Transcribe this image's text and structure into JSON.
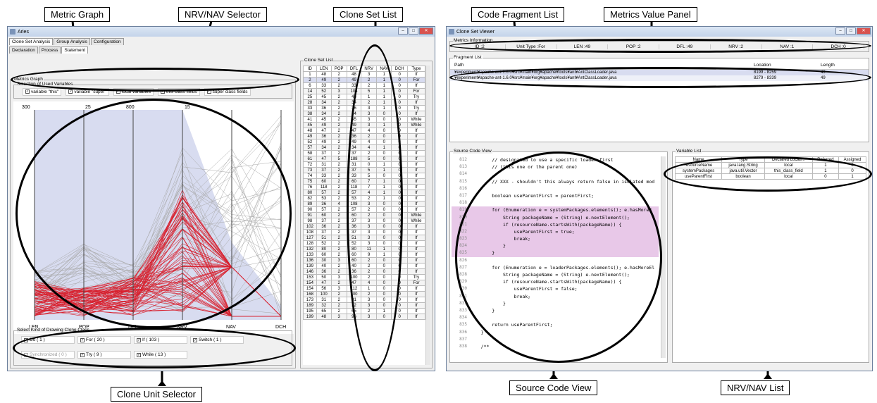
{
  "callouts": {
    "metric_graph": "Metric Graph",
    "nrv_nav_selector": "NRV/NAV Selector",
    "clone_set_list": "Clone Set List",
    "clone_unit_selector": "Clone Unit Selector",
    "code_fragment_list": "Code Fragment List",
    "metrics_value_panel": "Metrics Value Panel",
    "source_code_view": "Source Code View",
    "nrv_nav_list": "NRV/NAV List"
  },
  "aries": {
    "title": "Aries",
    "top_tabs": [
      "Clone Set Analysis",
      "Group Analysis",
      "Configuration"
    ],
    "sub_tabs": [
      "Declaration",
      "Process",
      "Statement"
    ],
    "metrics_graph_title": "Metrics Graph",
    "selection_title": "Selection of Used Variables",
    "variables": [
      "variable \"this\"",
      "variable \"super\"",
      "local variables",
      "this class fields",
      "super class fields"
    ],
    "axis_labels": [
      "LEN",
      "POP",
      "DFL",
      "NRV",
      "NAV",
      "DCH"
    ],
    "axis_top": [
      "300",
      "25",
      "800",
      "15",
      "",
      ""
    ],
    "kind_title": "Select Kind of Drawing Clone Class",
    "kinds_row1": [
      "Do ( 1 )",
      "For ( 20 )",
      "If ( 103 )",
      "Switch ( 1 )"
    ],
    "kinds_row2": [
      "Synchronized ( 0 )",
      "Try ( 9 )",
      "While ( 13 )"
    ],
    "clone_list_title": "Clone Set List",
    "clone_headers": [
      "ID",
      "LEN",
      "POP",
      "DFL",
      "NRV",
      "NAV",
      "DCH",
      "Type"
    ],
    "clone_rows": [
      [
        "1",
        "48",
        "2",
        "48",
        "3",
        "1",
        "0",
        "If"
      ],
      [
        "2",
        "49",
        "2",
        "49",
        "2",
        "1",
        "0",
        "For"
      ],
      [
        "6",
        "33",
        "2",
        "33",
        "2",
        "1",
        "0",
        "If"
      ],
      [
        "14",
        "52",
        "3",
        "104",
        "5",
        "1",
        "0",
        "For"
      ],
      [
        "25",
        "45",
        "2",
        "45",
        "1",
        "1",
        "0",
        "Try"
      ],
      [
        "28",
        "34",
        "2",
        "34",
        "2",
        "1",
        "0",
        "If"
      ],
      [
        "33",
        "36",
        "2",
        "36",
        "3",
        "1",
        "0",
        "Try"
      ],
      [
        "38",
        "34",
        "2",
        "34",
        "3",
        "0",
        "0",
        "If"
      ],
      [
        "41",
        "45",
        "2",
        "45",
        "3",
        "0",
        "0",
        "While"
      ],
      [
        "45",
        "49",
        "2",
        "49",
        "3",
        "1",
        "0",
        "While"
      ],
      [
        "48",
        "47",
        "2",
        "47",
        "4",
        "0",
        "0",
        "If"
      ],
      [
        "49",
        "36",
        "2",
        "36",
        "2",
        "0",
        "0",
        "If"
      ],
      [
        "52",
        "49",
        "2",
        "49",
        "4",
        "0",
        "0",
        "If"
      ],
      [
        "57",
        "34",
        "2",
        "34",
        "4",
        "1",
        "0",
        "If"
      ],
      [
        "58",
        "37",
        "2",
        "37",
        "2",
        "0",
        "0",
        "If"
      ],
      [
        "61",
        "47",
        "5",
        "188",
        "5",
        "0",
        "0",
        "If"
      ],
      [
        "72",
        "31",
        "2",
        "31",
        "0",
        "1",
        "0",
        "If"
      ],
      [
        "73",
        "37",
        "2",
        "37",
        "5",
        "1",
        "0",
        "If"
      ],
      [
        "74",
        "33",
        "2",
        "33",
        "5",
        "0",
        "0",
        "If"
      ],
      [
        "75",
        "60",
        "2",
        "60",
        "7",
        "1",
        "0",
        "If"
      ],
      [
        "76",
        "118",
        "2",
        "118",
        "7",
        "1",
        "0",
        "If"
      ],
      [
        "80",
        "57",
        "2",
        "57",
        "4",
        "1",
        "0",
        "If"
      ],
      [
        "82",
        "53",
        "2",
        "53",
        "2",
        "1",
        "0",
        "If"
      ],
      [
        "89",
        "36",
        "4",
        "108",
        "3",
        "0",
        "0",
        "If"
      ],
      [
        "90",
        "57",
        "2",
        "57",
        "2",
        "0",
        "0",
        "If"
      ],
      [
        "91",
        "60",
        "2",
        "60",
        "2",
        "0",
        "0",
        "While"
      ],
      [
        "98",
        "37",
        "2",
        "37",
        "3",
        "0",
        "0",
        "While"
      ],
      [
        "102",
        "36",
        "2",
        "36",
        "3",
        "0",
        "0",
        "If"
      ],
      [
        "108",
        "37",
        "2",
        "37",
        "3",
        "0",
        "0",
        "If"
      ],
      [
        "127",
        "51",
        "2",
        "51",
        "3",
        "0",
        "0",
        "If"
      ],
      [
        "128",
        "52",
        "2",
        "52",
        "3",
        "0",
        "0",
        "If"
      ],
      [
        "132",
        "80",
        "2",
        "80",
        "11",
        "1",
        "0",
        "If"
      ],
      [
        "133",
        "60",
        "2",
        "60",
        "9",
        "1",
        "0",
        "If"
      ],
      [
        "136",
        "30",
        "3",
        "60",
        "2",
        "0",
        "0",
        "If"
      ],
      [
        "139",
        "40",
        "2",
        "40",
        "2",
        "0",
        "0",
        "If"
      ],
      [
        "146",
        "36",
        "2",
        "36",
        "2",
        "0",
        "0",
        "If"
      ],
      [
        "153",
        "50",
        "3",
        "100",
        "2",
        "0",
        "0",
        "Try"
      ],
      [
        "154",
        "47",
        "2",
        "47",
        "4",
        "0",
        "0",
        "For"
      ],
      [
        "154",
        "56",
        "3",
        "112",
        "1",
        "0",
        "0",
        "If"
      ],
      [
        "168",
        "100",
        "2",
        "100",
        "2",
        "0",
        "0",
        "If"
      ],
      [
        "173",
        "31",
        "2",
        "31",
        "3",
        "0",
        "0",
        "If"
      ],
      [
        "189",
        "32",
        "2",
        "32",
        "3",
        "0",
        "0",
        "If"
      ],
      [
        "195",
        "65",
        "2",
        "65",
        "2",
        "1",
        "0",
        "If"
      ],
      [
        "199",
        "48",
        "3",
        "96",
        "3",
        "0",
        "0",
        "If"
      ]
    ]
  },
  "viewer": {
    "title": "Clone Set Viewer",
    "metrics_info_title": "Metrics Information",
    "metrics": [
      "ID :2",
      "Unit Type :For",
      "LEN :49",
      "POP :2",
      "DFL :49",
      "NRV :2",
      "NAV :1",
      "DCH :0"
    ],
    "fragment_title": "Fragment List",
    "fragment_headers": [
      "Path",
      "Location",
      "Length"
    ],
    "fragments": [
      {
        "path": "¥experiment¥apache-ant-1.6.0¥src¥main¥org¥apache¥tools¥ant¥AntClassLoader.java",
        "loc": "8199 - 8259",
        "len": "49"
      },
      {
        "path": "¥experiment¥apache-ant-1.6.0¥src¥main¥org¥apache¥tools¥ant¥AntClassLoader.java",
        "loc": "8279 - 8339",
        "len": "49"
      }
    ],
    "source_title": "Source Code View",
    "code": [
      [
        "812",
        "        // designated to use a specific loader first"
      ],
      [
        "813",
        "        // (this one or the parent one)"
      ],
      [
        "814",
        ""
      ],
      [
        "815",
        "        // XXX - shouldn't this always return false in isolated mod"
      ],
      [
        "816",
        ""
      ],
      [
        "817",
        "        boolean useParentFirst = parentFirst;"
      ],
      [
        "818",
        ""
      ],
      [
        "819",
        "        for (Enumeration e = systemPackages.elements(); e.hasMoreE"
      ],
      [
        "820",
        "            String packageName = (String) e.nextElement();"
      ],
      [
        "821",
        "            if (resourceName.startsWith(packageName)) {"
      ],
      [
        "822",
        "                useParentFirst = true;"
      ],
      [
        "823",
        "                break;"
      ],
      [
        "824",
        "            }"
      ],
      [
        "825",
        "        }"
      ],
      [
        "826",
        ""
      ],
      [
        "827",
        "        for (Enumeration e = loaderPackages.elements(); e.hasMoreEl"
      ],
      [
        "828",
        "            String packageName = (String) e.nextElement();"
      ],
      [
        "829",
        "            if (resourceName.startsWith(packageName)) {"
      ],
      [
        "830",
        "                useParentFirst = false;"
      ],
      [
        "831",
        "                break;"
      ],
      [
        "832",
        "            }"
      ],
      [
        "833",
        "        }"
      ],
      [
        "834",
        ""
      ],
      [
        "835",
        "        return useParentFirst;"
      ],
      [
        "836",
        "    }"
      ],
      [
        "837",
        ""
      ],
      [
        "838",
        "    /**"
      ]
    ],
    "var_title": "Variable List",
    "var_headers": [
      "Name",
      "Type",
      "Declared Locati...",
      "Referred",
      "Assigned"
    ],
    "vars": [
      [
        "resourceName",
        "java.lang.String",
        "local",
        "1",
        "0"
      ],
      [
        "systemPackages",
        "java.util.Vector",
        "this_class_field",
        "1",
        "0"
      ],
      [
        "useParentFirst",
        "boolean",
        "local",
        "0",
        "1"
      ]
    ]
  }
}
